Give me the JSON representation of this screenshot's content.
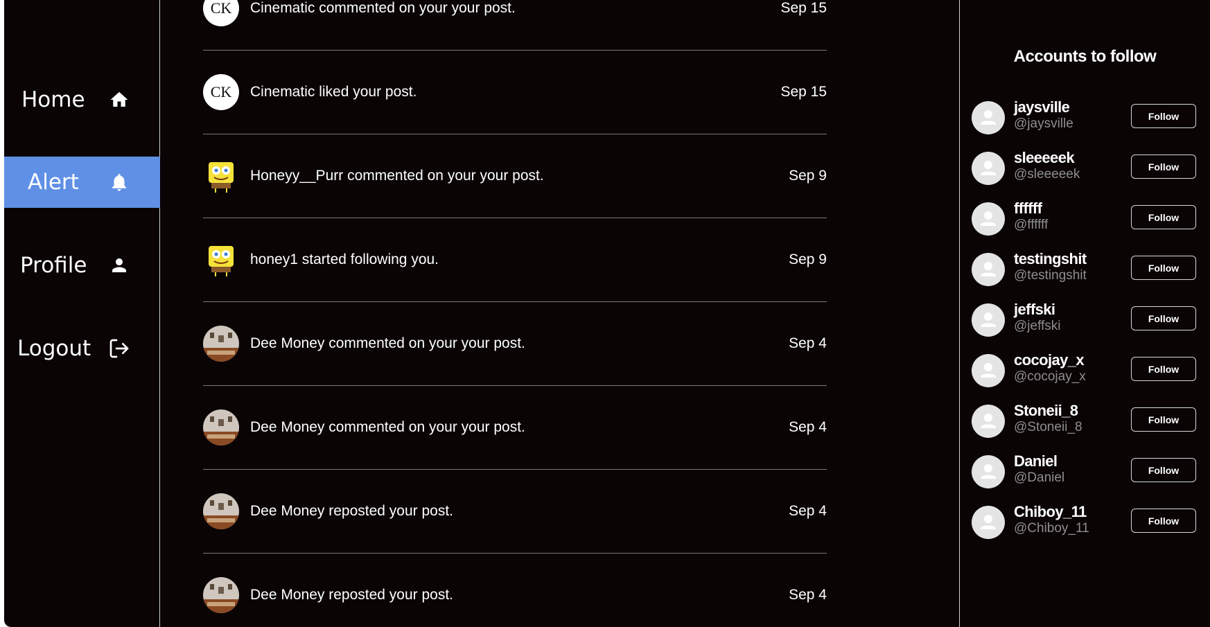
{
  "sidebar": {
    "items": [
      {
        "label": "Home",
        "icon": "home-icon"
      },
      {
        "label": "Alert",
        "icon": "bell-icon",
        "active": true
      },
      {
        "label": "Profile",
        "icon": "person-icon"
      },
      {
        "label": "Logout",
        "icon": "logout-icon"
      }
    ],
    "active_color": "#5f90e6"
  },
  "notifications": [
    {
      "user": "Cinematic",
      "avatar": "ck-logo-avatar",
      "text": "Cinematic commented on your your post.",
      "date": "Sep 15"
    },
    {
      "user": "Cinematic",
      "avatar": "ck-logo-avatar",
      "text": "Cinematic liked your post.",
      "date": "Sep 15"
    },
    {
      "user": "Honeyy__Purr",
      "avatar": "sponge-avatar",
      "text": "Honeyy__Purr commented on your your post.",
      "date": "Sep 9"
    },
    {
      "user": "honey1",
      "avatar": "sponge-avatar",
      "text": "honey1 started following you.",
      "date": "Sep 9"
    },
    {
      "user": "Dee Money",
      "avatar": "room-photo-avatar",
      "text": "Dee Money commented on your your post.",
      "date": "Sep 4"
    },
    {
      "user": "Dee Money",
      "avatar": "room-photo-avatar",
      "text": "Dee Money commented on your your post.",
      "date": "Sep 4"
    },
    {
      "user": "Dee Money",
      "avatar": "room-photo-avatar",
      "text": "Dee Money reposted your post.",
      "date": "Sep 4"
    },
    {
      "user": "Dee Money",
      "avatar": "room-photo-avatar",
      "text": "Dee Money reposted your post.",
      "date": "Sep 4"
    }
  ],
  "right_panel": {
    "title": "Accounts to follow",
    "follow_label": "Follow",
    "accounts": [
      {
        "name": "jaysville",
        "handle": "@jaysville"
      },
      {
        "name": "sleeeeek",
        "handle": "@sleeeeek"
      },
      {
        "name": "ffffff",
        "handle": "@ffffff"
      },
      {
        "name": "testingshit",
        "handle": "@testingshit"
      },
      {
        "name": "jeffski",
        "handle": "@jeffski"
      },
      {
        "name": "cocojay_x",
        "handle": "@cocojay_x"
      },
      {
        "name": "Stoneii_8",
        "handle": "@Stoneii_8"
      },
      {
        "name": "Daniel",
        "handle": "@Daniel"
      },
      {
        "name": "Chiboy_11",
        "handle": "@Chiboy_11"
      }
    ]
  },
  "colors": {
    "background": "#0a0405",
    "accent": "#5f90e6",
    "handle": "#8e8e8e"
  }
}
